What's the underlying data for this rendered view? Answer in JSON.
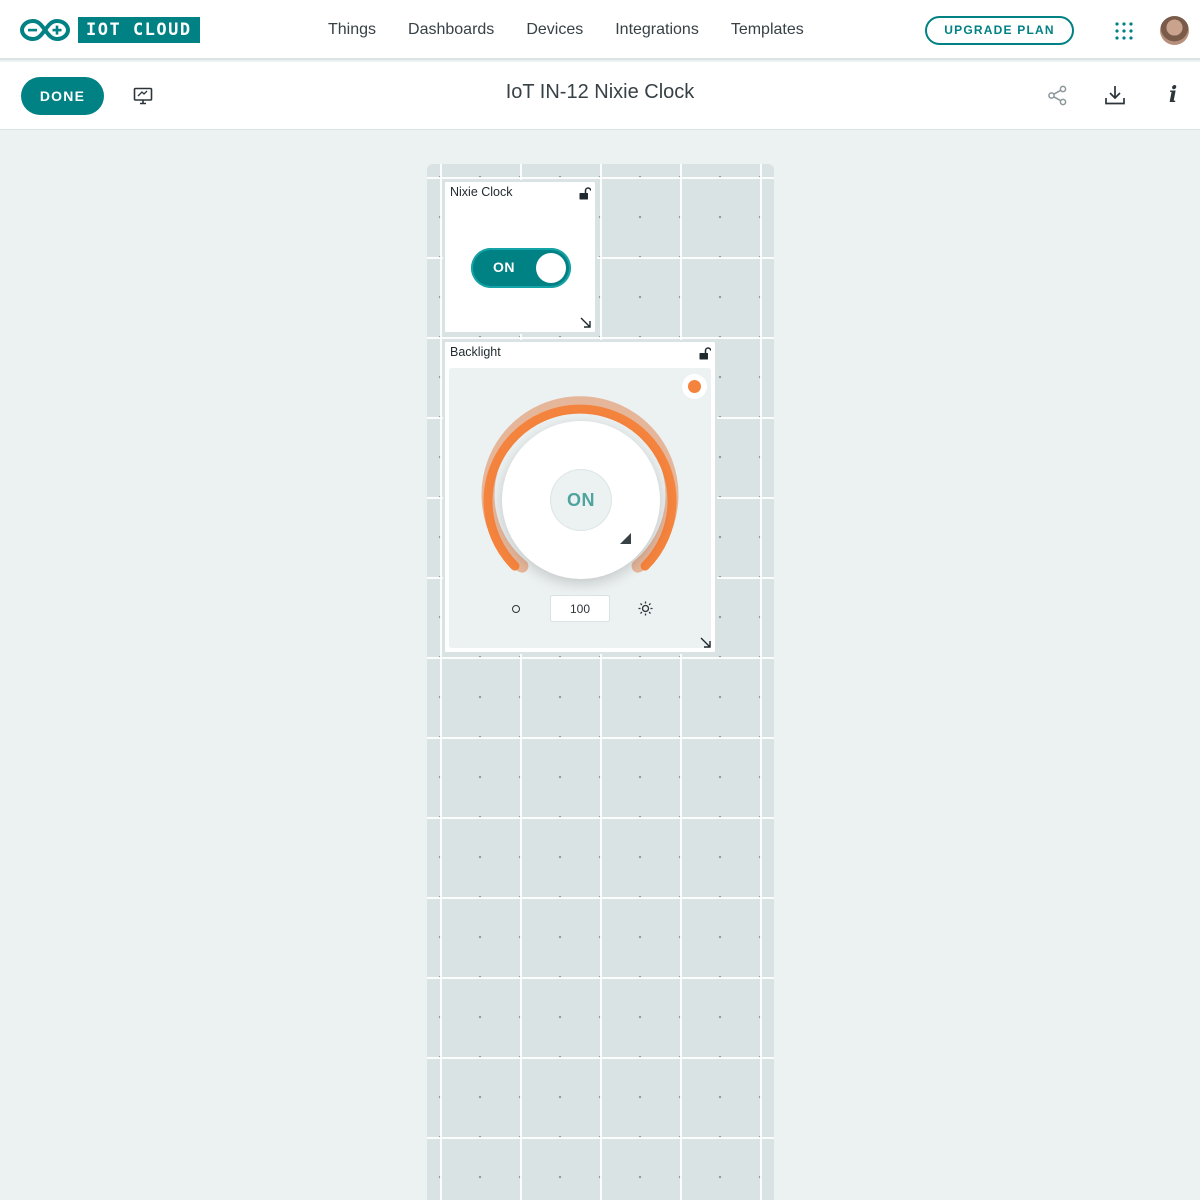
{
  "header": {
    "logo_text": "IOT CLOUD",
    "nav": [
      "Things",
      "Dashboards",
      "Devices",
      "Integrations",
      "Templates"
    ],
    "upgrade_label": "UPGRADE PLAN",
    "icons": [
      "arduino-logo-icon",
      "apps-grid-icon",
      "avatar"
    ]
  },
  "toolbar": {
    "done_label": "DONE",
    "title": "IoT IN-12 Nixie Clock",
    "icons": [
      "screen-icon",
      "share-icon",
      "download-icon",
      "info-icon"
    ],
    "info_glyph": "i"
  },
  "widgets": {
    "switch": {
      "title": "Nixie Clock",
      "state_label": "ON",
      "is_on": true
    },
    "dimmer": {
      "title": "Backlight",
      "state_label": "ON",
      "value": "100",
      "level_percent": 100,
      "status": "on"
    }
  },
  "colors": {
    "primary": "#008184",
    "accent": "#f4833d",
    "canvas": "#dae3e3",
    "background": "#ecf1f1"
  }
}
